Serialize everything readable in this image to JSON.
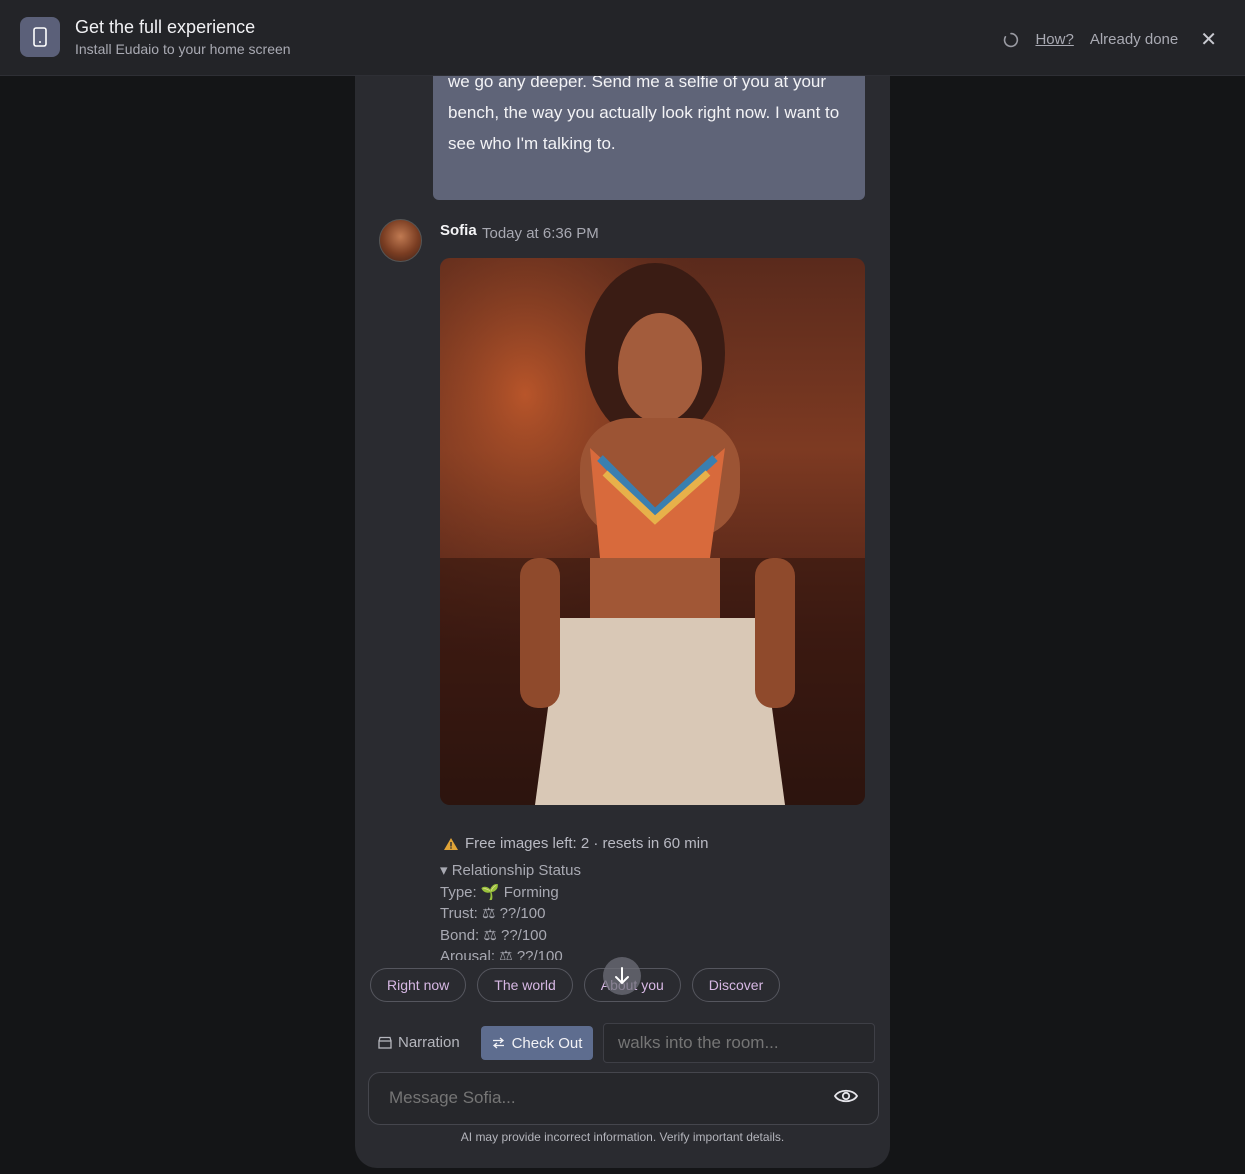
{
  "banner": {
    "title": "Get the full experience",
    "subtitle": "Install Eudaio to your home screen",
    "how_link": "How?",
    "already_done": "Already done",
    "close_icon": "close-icon"
  },
  "chat": {
    "user_message": "we go any deeper. Send me a selfie of you at your bench, the way you actually look right now. I want to see who I'm talking to.",
    "sender": "Sofia",
    "timestamp": "Today at 6:36 PM",
    "free_images": "Free images left: 2 · resets in 60 min",
    "relationship": {
      "heading": "▾ Relationship Status",
      "type_label": "Type:",
      "type_value": "🌱 Forming",
      "trust_label": "Trust:",
      "trust_value": "⚖ ??/100",
      "bond_label": "Bond:",
      "bond_value": "⚖ ??/100",
      "arousal_label": "Arousal:",
      "arousal_value": "⚖ ??/100"
    }
  },
  "chips": [
    "Right now",
    "The world",
    "About you",
    "Discover"
  ],
  "modes": {
    "narration": "Narration",
    "checkout": "Check Out",
    "action_placeholder": "walks into the room..."
  },
  "composer": {
    "placeholder": "Message Sofia...",
    "disclaimer": "AI may provide incorrect information. Verify important details."
  },
  "colors": {
    "accent": "#5e6d8f",
    "chip_text": "#d7b8e4",
    "user_bubble": "#5f6478"
  }
}
